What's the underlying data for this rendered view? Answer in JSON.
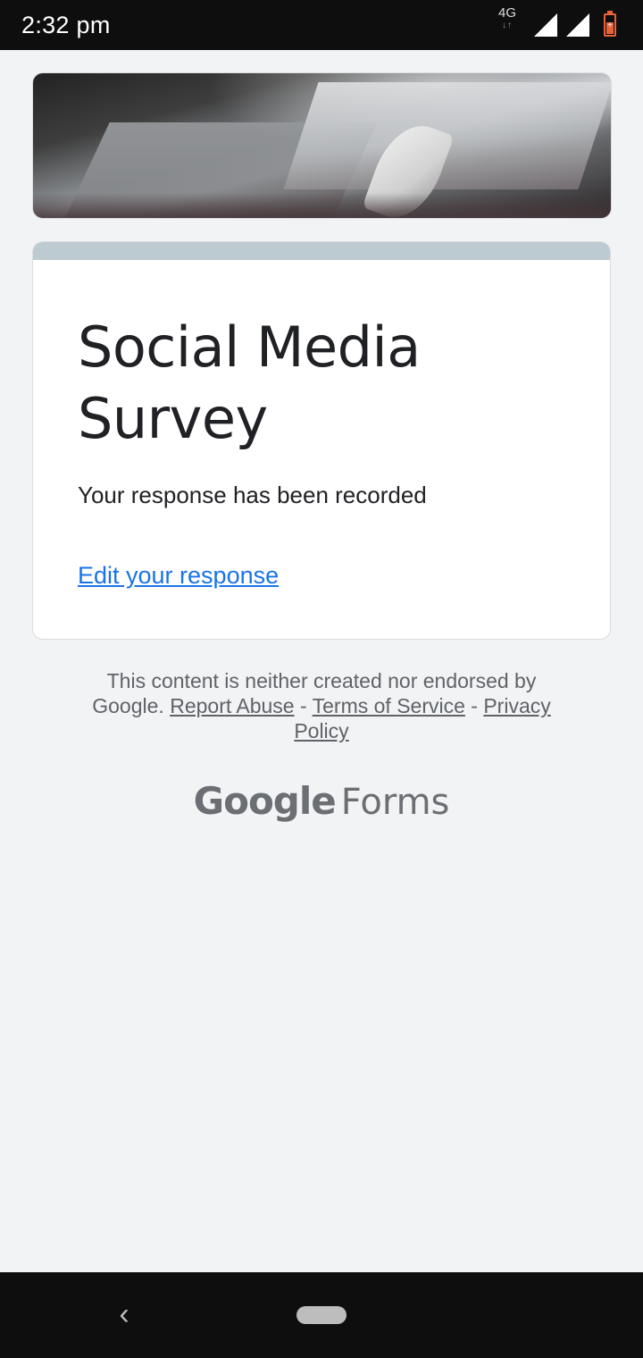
{
  "status_bar": {
    "time": "2:32 pm",
    "network": "4G",
    "icons": [
      "network-type-icon",
      "signal-icon",
      "signal-icon",
      "battery-charging-icon"
    ],
    "battery_color": "#e8623c"
  },
  "header_image": {
    "icon": "book-quill-image"
  },
  "card": {
    "accent_color": "#bccbd1",
    "title": "Social Media Survey",
    "confirmation": "Your response has been recorded",
    "edit_link": "Edit your response",
    "link_color": "#1a73e8"
  },
  "footer": {
    "disclaimer": "This content is neither created nor endorsed by Google.",
    "report_abuse": "Report Abuse",
    "separator": "-",
    "terms": "Terms of Service",
    "privacy": "Privacy Policy"
  },
  "brand": {
    "google": "Google",
    "forms": "Forms"
  },
  "nav_bar": {
    "icons": [
      "back-icon",
      "home-pill-icon"
    ]
  }
}
